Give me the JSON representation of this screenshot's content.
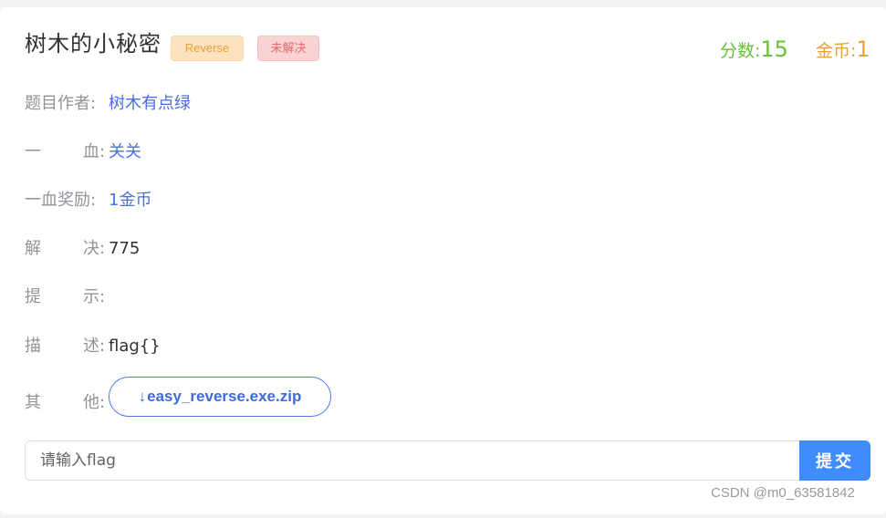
{
  "challenge": {
    "title": "树木的小秘密",
    "category": "Reverse",
    "status": "未解决",
    "score_label": "分数:",
    "score_value": "15",
    "coin_label": "金币:",
    "coin_value": "1"
  },
  "details": {
    "author_label": "题目作者:",
    "author_value": "树木有点绿",
    "first_blood_label_1": "一",
    "first_blood_label_2": "血",
    "first_blood_value": "关关",
    "first_blood_reward_label": "一血奖励:",
    "first_blood_reward_value": "1金币",
    "solved_label_1": "解",
    "solved_label_2": "决",
    "solved_value": "775",
    "hint_label_1": "提",
    "hint_label_2": "示",
    "hint_value": "",
    "desc_label_1": "描",
    "desc_label_2": "述",
    "desc_value": "flag{}",
    "other_label_1": "其",
    "other_label_2": "他",
    "attachment_icon": "↓",
    "attachment_name": "easy_reverse.exe.zip"
  },
  "submit": {
    "placeholder": "请输入flag",
    "button_label": "提交"
  },
  "colors": {
    "accent_blue": "#3f8cff",
    "score_green": "#67c23a",
    "coin_orange": "#e6a23c",
    "status_red": "#e46a6a"
  },
  "watermark": "CSDN @m0_63581842"
}
